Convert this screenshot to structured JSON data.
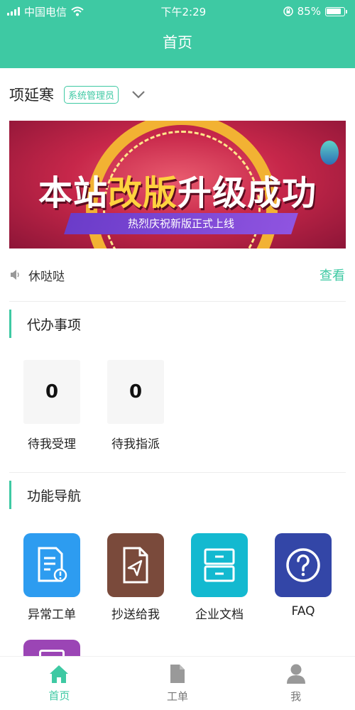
{
  "status_bar": {
    "carrier": "中国电信",
    "time": "下午2:29",
    "battery": "85%"
  },
  "header": {
    "title": "首页"
  },
  "user": {
    "name": "项延寒",
    "role": "系统管理员"
  },
  "banner": {
    "headline_part1": "本站",
    "headline_part2": "改版",
    "headline_part3": "升级",
    "headline_part4": "成功",
    "subtitle": "热烈庆祝新版正式上线"
  },
  "notice": {
    "text": "休哒哒",
    "link": "查看"
  },
  "todo": {
    "title": "代办事项",
    "items": [
      {
        "count": "0",
        "label": "待我受理"
      },
      {
        "count": "0",
        "label": "待我指派"
      }
    ]
  },
  "nav": {
    "title": "功能导航",
    "items": [
      {
        "label": "异常工单",
        "icon": "doc-warning-icon",
        "color": "#2d9cf0"
      },
      {
        "label": "抄送给我",
        "icon": "send-file-icon",
        "color": "#7a4a3b"
      },
      {
        "label": "企业文档",
        "icon": "cabinet-icon",
        "color": "#13b9d0"
      },
      {
        "label": "FAQ",
        "icon": "question-icon",
        "color": "#3346a7"
      }
    ]
  },
  "tabbar": {
    "items": [
      {
        "label": "首页",
        "icon": "home-icon"
      },
      {
        "label": "工单",
        "icon": "file-icon"
      },
      {
        "label": "我",
        "icon": "user-icon"
      }
    ]
  },
  "colors": {
    "accent": "#3ec9a3"
  }
}
